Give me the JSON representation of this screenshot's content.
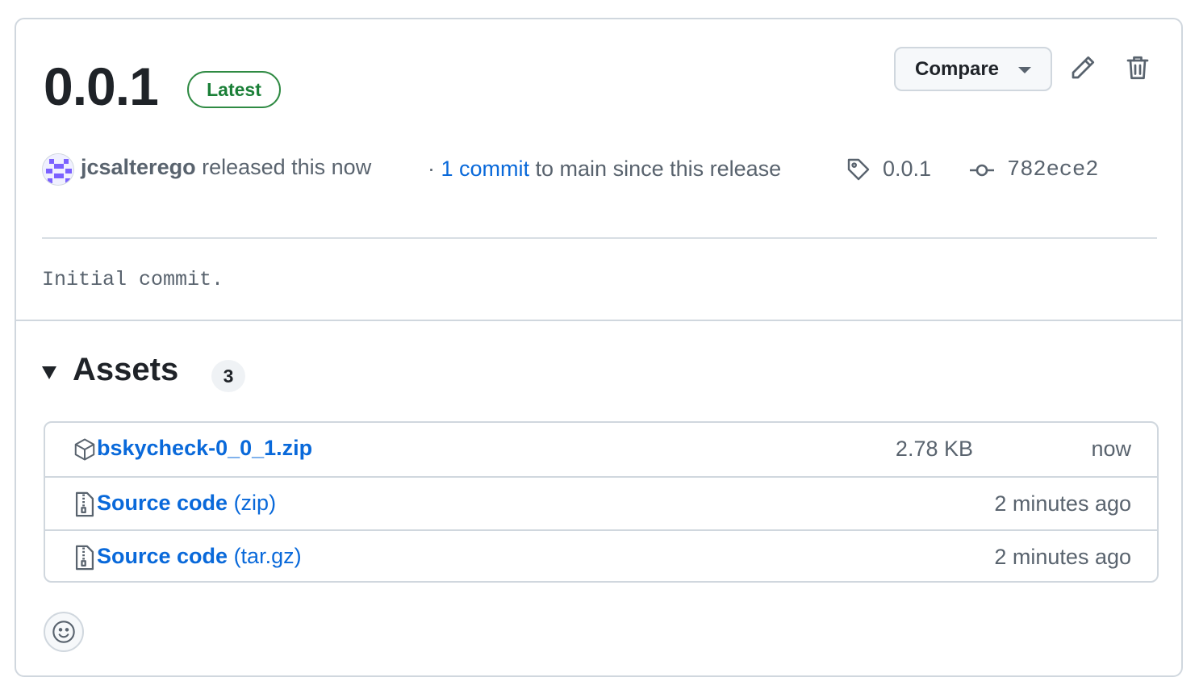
{
  "release": {
    "version": "0.0.1",
    "badge": "Latest",
    "compare_label": "Compare"
  },
  "meta": {
    "username": "jcsalterego",
    "released_text": " released this now",
    "bullet": "· ",
    "commits_link": "1 commit",
    "commits_suffix": " to main since this release",
    "tag": "0.0.1",
    "commit_sha": "782ece2"
  },
  "body": {
    "text": "Initial commit."
  },
  "assets": {
    "title": "Assets",
    "count": "3",
    "items": [
      {
        "name": "bskycheck-0_0_1.zip",
        "suffix": "",
        "size": "2.78 KB",
        "time": "now"
      },
      {
        "name": "Source code",
        "suffix": " (zip)",
        "size": "",
        "time": "2 minutes ago"
      },
      {
        "name": "Source code",
        "suffix": " (tar.gz)",
        "size": "",
        "time": "2 minutes ago"
      }
    ]
  },
  "colors": {
    "link": "#0969da",
    "latest_green": "#1a7f37",
    "muted": "#59636e",
    "border": "#d0d7de"
  },
  "icons": {
    "edit": "pencil-icon",
    "delete": "trash-icon",
    "tag": "tag-icon",
    "commit": "git-commit-icon",
    "package": "package-icon",
    "zip": "file-zip-icon",
    "reaction": "smiley-icon"
  }
}
